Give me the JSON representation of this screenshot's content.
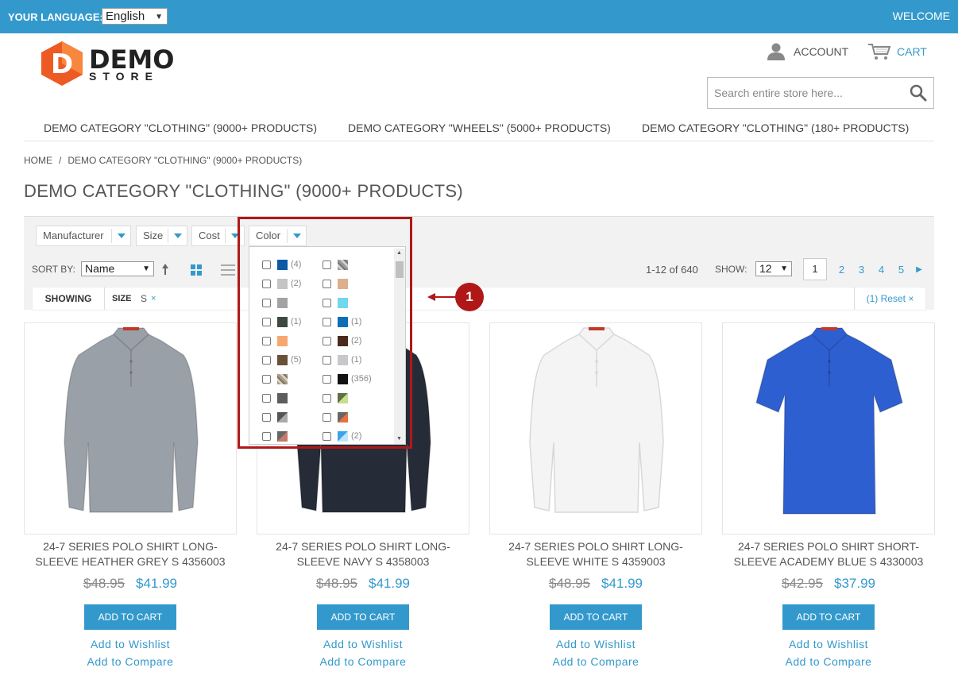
{
  "topbar": {
    "language_label": "YOUR LANGUAGE:",
    "language_value": "English",
    "welcome": "WELCOME"
  },
  "header": {
    "logo_letter": "D",
    "logo_word": "DEMO",
    "logo_sub": "STORE",
    "account": "ACCOUNT",
    "cart": "CART",
    "search_placeholder": "Search entire store here..."
  },
  "nav": [
    "DEMO CATEGORY \"CLOTHING\" (9000+ PRODUCTS)",
    "DEMO CATEGORY \"WHEELS\" (5000+ PRODUCTS)",
    "DEMO CATEGORY \"CLOTHING\" (180+ PRODUCTS)"
  ],
  "breadcrumb": {
    "home": "HOME",
    "separator": "/",
    "current": "DEMO CATEGORY \"CLOTHING\" (9000+ PRODUCTS)"
  },
  "page_title": "DEMO CATEGORY \"CLOTHING\" (9000+ PRODUCTS)",
  "filters": [
    "Manufacturer",
    "Size",
    "Cost",
    "Color"
  ],
  "toolbar": {
    "sort_label": "SORT BY:",
    "sort_value": "Name",
    "count": "1-12 of 640",
    "show_label": "SHOW:",
    "show_value": "12",
    "pages": [
      "1",
      "2",
      "3",
      "4",
      "5"
    ]
  },
  "showing": {
    "label": "SHOWING",
    "filter_name": "SIZE",
    "filter_value": "S",
    "remove": "×",
    "reset": "(1) Reset ×"
  },
  "color_options": {
    "left": [
      {
        "color": "#0b5aa6",
        "count": "(4)"
      },
      {
        "color": "#c4c4c4",
        "count": "(2)"
      },
      {
        "color": "#a3a3a3",
        "count": ""
      },
      {
        "color": "#3e4a40",
        "count": "(1)"
      },
      {
        "color": "#f7a86f",
        "count": ""
      },
      {
        "color": "#6b5038",
        "count": "(5)"
      },
      {
        "color": "pattern-camo",
        "count": ""
      },
      {
        "color": "#5d5d5d",
        "count": ""
      },
      {
        "color": "split-grey",
        "count": ""
      },
      {
        "color": "split-rust",
        "count": ""
      }
    ],
    "right": [
      {
        "color": "pattern-camo-grey",
        "count": ""
      },
      {
        "color": "#dcb08d",
        "count": ""
      },
      {
        "color": "#6fd8ec",
        "count": ""
      },
      {
        "color": "#0a6fb8",
        "count": "(1)"
      },
      {
        "color": "#4a2a1c",
        "count": "(2)"
      },
      {
        "color": "#c7c7cc",
        "count": "(1)"
      },
      {
        "color": "#111111",
        "count": "(356)"
      },
      {
        "color": "split-olive",
        "count": ""
      },
      {
        "color": "split-orange",
        "count": ""
      },
      {
        "color": "split-blue",
        "count": "(2)"
      }
    ]
  },
  "callout": "1",
  "products": [
    {
      "name": "24-7 SERIES POLO SHIRT LONG-SLEEVE HEATHER GREY S 4356003",
      "old_price": "$48.95",
      "price": "$41.99",
      "shirt_color": "#9aa0a8",
      "long": true
    },
    {
      "name": "24-7 SERIES POLO SHIRT LONG-SLEEVE NAVY S 4358003",
      "old_price": "$48.95",
      "price": "$41.99",
      "shirt_color": "#262b38",
      "long": true
    },
    {
      "name": "24-7 SERIES POLO SHIRT LONG-SLEEVE WHITE S 4359003",
      "old_price": "$48.95",
      "price": "$41.99",
      "shirt_color": "#f4f4f4",
      "long": true
    },
    {
      "name": "24-7 SERIES POLO SHIRT SHORT-SLEEVE ACADEMY BLUE S 4330003",
      "old_price": "$42.95",
      "price": "$37.99",
      "shirt_color": "#2e5fd1",
      "long": false
    }
  ],
  "product_actions": {
    "add_to_cart": "ADD TO CART",
    "wishlist": "Add to Wishlist",
    "compare": "Add to Compare"
  },
  "colors": {
    "accent": "#3399cc",
    "highlight": "#b01818",
    "logo_orange": "#ee5a24"
  }
}
